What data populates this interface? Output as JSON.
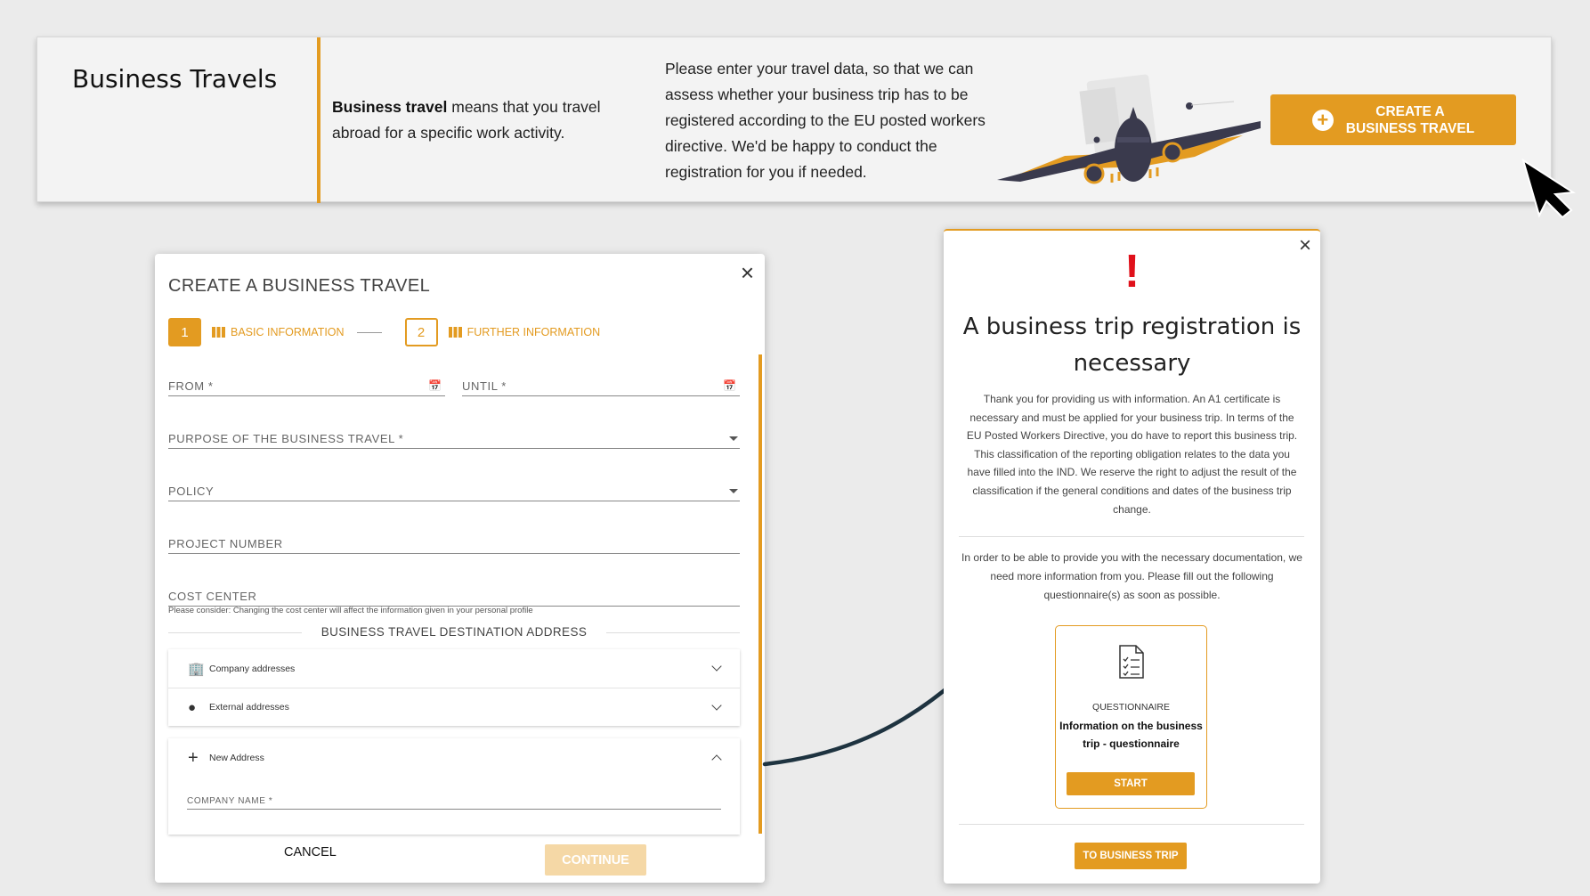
{
  "colors": {
    "accent": "#e39b21",
    "danger": "#e0111b",
    "background": "#ebebeb",
    "cursor": "#000000",
    "arrow": "#1e3340"
  },
  "banner": {
    "title": "Business Travels",
    "definition_bold": "Business travel",
    "definition_rest": " means that you travel abroad for a specific work activity.",
    "description": "Please enter your travel data, so that we can assess whether your business trip has to be registered according to the EU posted workers directive. We'd be happy to conduct the registration for you if needed.",
    "create_button_line1": "CREATE A",
    "create_button_line2": "BUSINESS TRAVEL",
    "plus_icon": "plus-circle-icon"
  },
  "create_dialog": {
    "title": "CREATE A BUSINESS TRAVEL",
    "close": "×",
    "steps": [
      {
        "number": "1",
        "label": "BASIC INFORMATION",
        "active": true
      },
      {
        "number": "2",
        "label": "FURTHER INFORMATION",
        "active": false
      }
    ],
    "fields": {
      "from": "FROM *",
      "until": "UNTIL *",
      "purpose": "PURPOSE OF THE BUSINESS TRAVEL *",
      "policy": "POLICY",
      "project_number": "PROJECT NUMBER",
      "cost_center": "COST CENTER"
    },
    "cost_center_hint": "Please consider: Changing the cost center will affect the information given in your personal profile",
    "destination_title": "BUSINESS TRAVEL DESTINATION ADDRESS",
    "address_options": [
      {
        "label": "Company addresses",
        "icon": "building-icon"
      },
      {
        "label": "External addresses",
        "icon": "map-pin-icon"
      }
    ],
    "new_address_label": "New Address",
    "company_name_label": "COMPANY NAME *",
    "cancel": "CANCEL",
    "continue": "CONTINUE"
  },
  "result_dialog": {
    "close": "×",
    "alert_symbol": "!",
    "title": "A business trip registration is necessary",
    "text1": "Thank you for providing us with information. An A1 certificate is necessary and must be applied for your business trip. In terms of the EU Posted Workers Directive, you do have to report this business trip. This classification of the reporting obligation relates to the data you have filled into the IND. We reserve the right to adjust the result of the classification if the general conditions and dates of the business trip change.",
    "text2": "In order to be able to provide you with the necessary documentation, we need more information from you. Please fill out the following questionnaire(s) as soon as possible.",
    "questionnaire": {
      "kind": "QUESTIONNAIRE",
      "name": "Information on the business trip - questionnaire",
      "start": "START",
      "icon": "document-checklist-icon"
    },
    "to_trip": "TO BUSINESS TRIP"
  }
}
